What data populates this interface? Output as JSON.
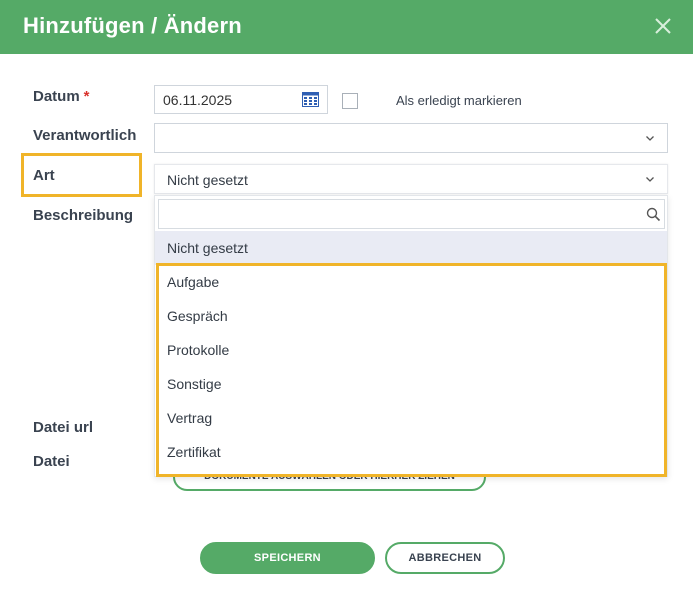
{
  "dialog": {
    "title": "Hinzufügen / Ändern"
  },
  "form": {
    "date_label": "Datum",
    "required_marker": "*",
    "date_value": "06.11.2025",
    "done_checkbox_label": "Als erledigt markieren",
    "done_checked": false,
    "responsible_label": "Verantwortlich",
    "responsible_value": "",
    "type_label": "Art",
    "type_value": "Nicht gesetzt",
    "description_label": "Beschreibung",
    "file_url_label": "Datei url",
    "file_label": "Datei",
    "file_button_label": "DOKUMENTE AUSWÄHLEN ODER HIERHER ZIEHEN"
  },
  "dropdown": {
    "search_placeholder": "",
    "selected": "Nicht gesetzt",
    "options": [
      "Nicht gesetzt",
      "Aufgabe",
      "Gespräch",
      "Protokolle",
      "Sonstige",
      "Vertrag",
      "Zertifikat"
    ]
  },
  "actions": {
    "save_label": "SPEICHERN",
    "cancel_label": "ABBRECHEN"
  },
  "colors": {
    "header": "#55aa67",
    "required": "#d9312b",
    "highlight": "#f0b429",
    "selected_option_bg": "#e9ebf4",
    "calendar_icon": "#2f5fb3"
  },
  "icons": {
    "close": "close-icon",
    "calendar": "calendar-icon",
    "chevron": "chevron-down-icon",
    "search": "search-icon"
  }
}
